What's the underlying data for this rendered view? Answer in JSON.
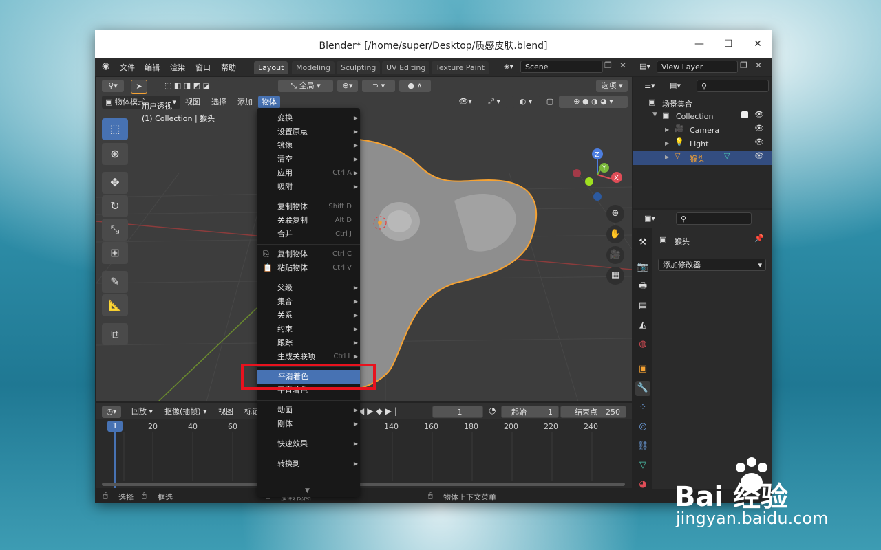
{
  "window": {
    "title": "Blender* [/home/super/Desktop/质感皮肤.blend]"
  },
  "topbar": {
    "menus": [
      "文件",
      "编辑",
      "渲染",
      "窗口",
      "帮助"
    ],
    "workspaces": [
      "Layout",
      "Modeling",
      "Sculpting",
      "UV Editing",
      "Texture Paint"
    ],
    "scene": "Scene",
    "view_layer": "View Layer"
  },
  "viewport": {
    "transform_orientation": "全局",
    "options_label": "选项",
    "mode": "物体模式",
    "header_menus": [
      "视图",
      "选择",
      "添加",
      "物体"
    ],
    "overlay_line1": "用户透视",
    "overlay_line2": "(1) Collection | 猴头"
  },
  "context_menu": {
    "items": [
      {
        "label": "变换",
        "shortcut": "",
        "submenu": true
      },
      {
        "label": "设置原点",
        "shortcut": "",
        "submenu": true
      },
      {
        "label": "镜像",
        "shortcut": "",
        "submenu": true
      },
      {
        "label": "清空",
        "shortcut": "",
        "submenu": true
      },
      {
        "label": "应用",
        "shortcut": "Ctrl A",
        "submenu": true
      },
      {
        "label": "吸附",
        "shortcut": "",
        "submenu": true
      },
      {
        "label": "复制物体",
        "shortcut": "Shift D",
        "submenu": false
      },
      {
        "label": "关联复制",
        "shortcut": "Alt D",
        "submenu": false
      },
      {
        "label": "合并",
        "shortcut": "Ctrl J",
        "submenu": false
      },
      {
        "label": "复制物体",
        "shortcut": "Ctrl C",
        "submenu": false
      },
      {
        "label": "粘贴物体",
        "shortcut": "Ctrl V",
        "submenu": false
      },
      {
        "label": "父级",
        "shortcut": "",
        "submenu": true
      },
      {
        "label": "集合",
        "shortcut": "",
        "submenu": true
      },
      {
        "label": "关系",
        "shortcut": "",
        "submenu": true
      },
      {
        "label": "约束",
        "shortcut": "",
        "submenu": true
      },
      {
        "label": "跟踪",
        "shortcut": "",
        "submenu": true
      },
      {
        "label": "生成关联项",
        "shortcut": "Ctrl L",
        "submenu": true
      },
      {
        "label": "平滑着色",
        "shortcut": "",
        "submenu": false
      },
      {
        "label": "平直着色",
        "shortcut": "",
        "submenu": false
      },
      {
        "label": "动画",
        "shortcut": "",
        "submenu": true
      },
      {
        "label": "刚体",
        "shortcut": "",
        "submenu": true
      },
      {
        "label": "快速效果",
        "shortcut": "",
        "submenu": true
      },
      {
        "label": "转换到",
        "shortcut": "",
        "submenu": true
      }
    ],
    "more_arrow": "▼"
  },
  "timeline": {
    "menus": [
      "回放",
      "抠像(插帧)",
      "视图",
      "标记"
    ],
    "current_frame": "1",
    "start_label": "起始",
    "start_value": "1",
    "end_label": "结束点",
    "end_value": "250",
    "ruler": [
      "1",
      "20",
      "40",
      "60",
      "140",
      "160",
      "180",
      "200",
      "220",
      "240"
    ]
  },
  "outliner": {
    "root": "场景集合",
    "collection": "Collection",
    "objects": [
      "Camera",
      "Light",
      "猴头"
    ]
  },
  "properties": {
    "object_name": "猴头",
    "add_modifier": "添加修改器"
  },
  "statusbar": {
    "left1": "选择",
    "left2": "框选",
    "middle": "旋转视图",
    "right": "物体上下文菜单"
  },
  "watermark": {
    "brand": "Bai  经验",
    "url": "jingyan.baidu.com"
  },
  "colors": {
    "accent": "#4772b3",
    "highlight_box": "#e8121e",
    "selection_orange": "#f5a233"
  }
}
